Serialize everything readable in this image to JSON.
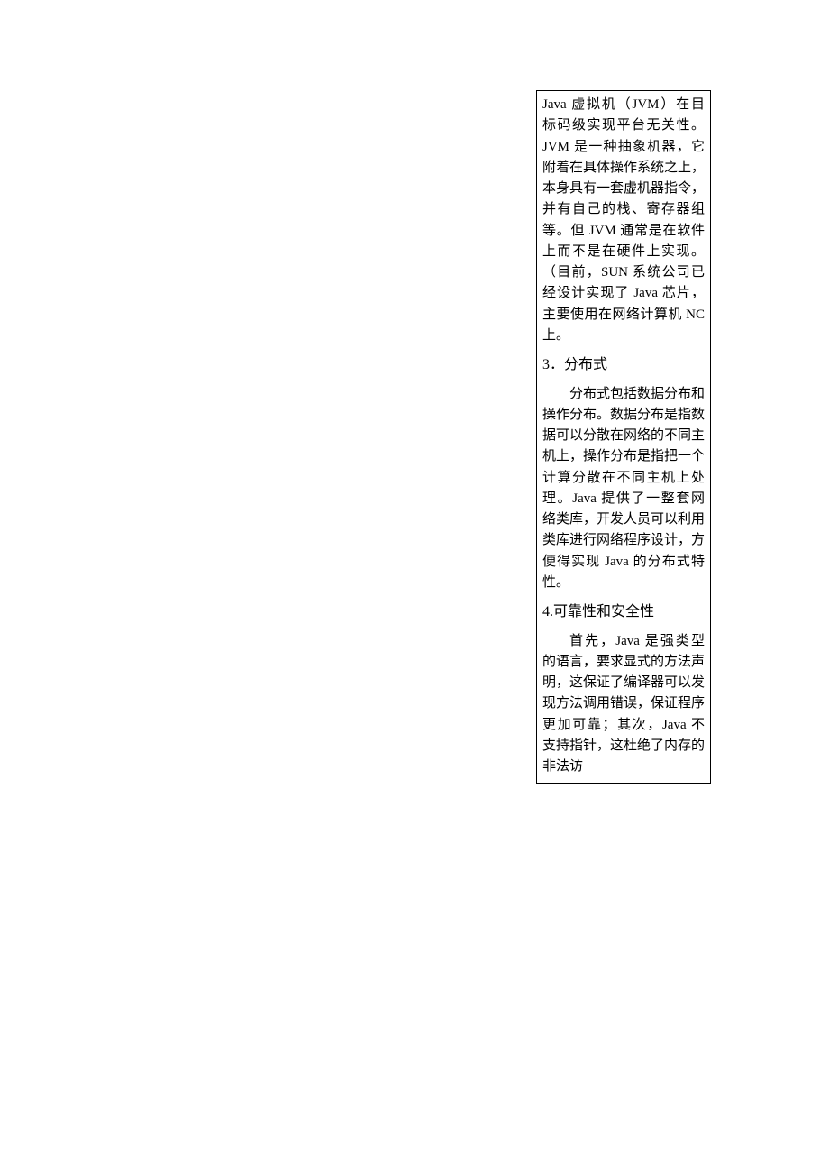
{
  "paragraphs": {
    "p1": "Java 虚拟机（JVM）在目标码级实现平台无关性。JVM 是一种抽象机器，它附着在具体操作系统之上，本身具有一套虚机器指令，并有自己的栈、寄存器组等。但 JVM 通常是在软件上而不是在硬件上实现。（目前，SUN 系统公司已经设计实现了 Java 芯片，主要使用在网络计算机 NC 上。",
    "p2": "分布式包括数据分布和操作分布。数据分布是指数据可以分散在网络的不同主机上，操作分布是指把一个计算分散在不同主机上处理。Java 提供了一整套网络类库，开发人员可以利用类库进行网络程序设计，方便得实现 Java 的分布式特性。",
    "p3": "首先，Java 是强类型的语言，要求显式的方法声明，这保证了编译器可以发现方法调用错误，保证程序更加可靠；其次，Java 不支持指针，这杜绝了内存的非法访"
  },
  "headings": {
    "h3": "3．分布式",
    "h4": "4.可靠性和安全性"
  }
}
